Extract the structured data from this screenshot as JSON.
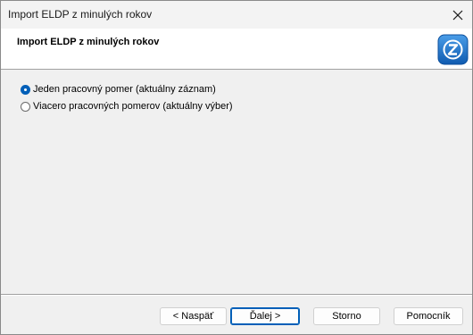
{
  "window": {
    "title": "Import ELDP z minulých rokov",
    "close_icon": "close-icon"
  },
  "header": {
    "title": "Import ELDP z minulých rokov",
    "logo_icon": "app-logo-icon",
    "logo_color": "#1f6fc4"
  },
  "options": [
    {
      "label": "Jeden pracovný pomer (aktuálny záznam)",
      "checked": true
    },
    {
      "label": "Viacero pracovných pomerov (aktuálny výber)",
      "checked": false
    }
  ],
  "buttons": {
    "back": "< Naspäť",
    "next": "Ďalej >",
    "cancel": "Storno",
    "help": "Pomocník"
  },
  "colors": {
    "accent": "#005fb8"
  }
}
